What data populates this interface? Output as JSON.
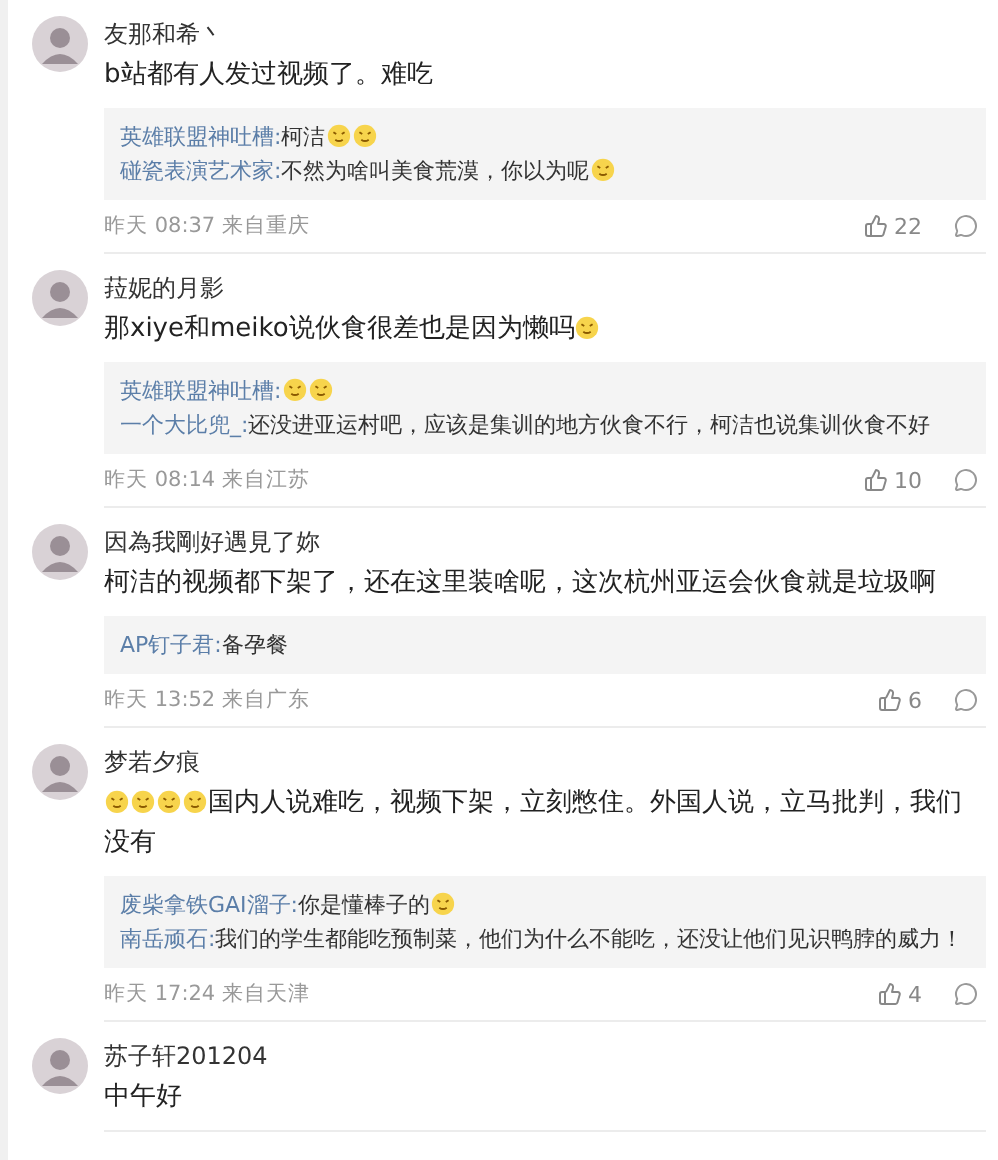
{
  "comments": [
    {
      "user": "友那和希丶",
      "body": [
        {
          "kind": "text",
          "text": "b站都有人发过视频了。难吃"
        }
      ],
      "replies": [
        {
          "user": "英雄联盟神吐槽:",
          "parts": [
            {
              "kind": "text",
              "text": "柯洁"
            },
            {
              "kind": "emoji"
            },
            {
              "kind": "emoji"
            }
          ]
        },
        {
          "user": "碰瓷表演艺术家:",
          "parts": [
            {
              "kind": "text",
              "text": "不然为啥叫美食荒漠，你以为呢"
            },
            {
              "kind": "emoji"
            }
          ]
        }
      ],
      "time": "昨天 08:37 来自重庆",
      "likes": "22"
    },
    {
      "user": "菈妮的月影",
      "body": [
        {
          "kind": "text",
          "text": "那xiye和meiko说伙食很差也是因为懒吗"
        },
        {
          "kind": "emoji"
        }
      ],
      "replies": [
        {
          "user": "英雄联盟神吐槽:",
          "parts": [
            {
              "kind": "emoji"
            },
            {
              "kind": "emoji"
            }
          ]
        },
        {
          "user": "一个大比兜_:",
          "parts": [
            {
              "kind": "text",
              "text": "还没进亚运村吧，应该是集训的地方伙食不行，柯洁也说集训伙食不好"
            }
          ]
        }
      ],
      "time": "昨天 08:14 来自江苏",
      "likes": "10"
    },
    {
      "user": "因為我剛好遇見了妳",
      "body": [
        {
          "kind": "text",
          "text": "柯洁的视频都下架了，还在这里装啥呢，这次杭州亚运会伙食就是垃圾啊"
        }
      ],
      "replies": [
        {
          "user": "AP钉子君:",
          "parts": [
            {
              "kind": "text",
              "text": "备孕餐"
            }
          ]
        }
      ],
      "time": "昨天 13:52 来自广东",
      "likes": "6"
    },
    {
      "user": "梦若夕痕",
      "body": [
        {
          "kind": "emoji"
        },
        {
          "kind": "emoji"
        },
        {
          "kind": "emoji"
        },
        {
          "kind": "emoji"
        },
        {
          "kind": "text",
          "text": "国内人说难吃，视频下架，立刻憋住。外国人说，立马批判，我们没有"
        }
      ],
      "replies": [
        {
          "user": "废柴拿铁GAI溜子:",
          "parts": [
            {
              "kind": "text",
              "text": "你是懂棒子的"
            },
            {
              "kind": "emoji"
            }
          ]
        },
        {
          "user": "南岳顽石:",
          "parts": [
            {
              "kind": "text",
              "text": "我们的学生都能吃预制菜，他们为什么不能吃，还没让他们见识鸭脖的威力！"
            }
          ]
        }
      ],
      "time": "昨天 17:24 来自天津",
      "likes": "4"
    },
    {
      "user": "苏子轩201204",
      "body": [
        {
          "kind": "text",
          "text": "中午好"
        }
      ]
    }
  ]
}
